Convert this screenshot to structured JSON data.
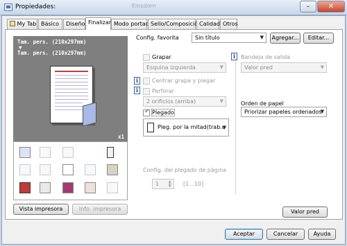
{
  "window": {
    "title": "Propiedades:",
    "title_faded": "Einsdorn"
  },
  "tabs": [
    {
      "label": "My Tab"
    },
    {
      "label": "Básico"
    },
    {
      "label": "Diseño"
    },
    {
      "label": "Finalizar"
    },
    {
      "label": "Modo portada"
    },
    {
      "label": "Sello/Composición"
    },
    {
      "label": "Calidad"
    },
    {
      "label": "Otros"
    }
  ],
  "preview": {
    "line1": "Tam. pers. (210x297mm)",
    "arrow": "▼",
    "line2": "Tam. pers. (210x297mm)",
    "copies": "x1"
  },
  "left_buttons": {
    "printer_view": "Vista impresora",
    "printer_info": "Info. impresora"
  },
  "favorites": {
    "label": "Config. favorita",
    "value": "Sin título",
    "add": "Agregar...",
    "edit": "Editar..."
  },
  "staple": {
    "label": "Grapar",
    "position": "Esquina izquierda"
  },
  "center_staple": {
    "label": "Centrar grapa y plegar"
  },
  "punch": {
    "label": "Perforar",
    "option": "2 orificios (arriba)"
  },
  "fold": {
    "label": "Plegado",
    "option": "Pleg. por la mitad(trab.c"
  },
  "output_tray": {
    "label": "Bandeja de salida",
    "value": "Valor pred"
  },
  "paper_order": {
    "label": "Orden de papel",
    "value": "Priorizar papeles ordenados"
  },
  "fold_pages": {
    "label": "Config. del plegado de página",
    "value": "1",
    "range": "[1...10]"
  },
  "defaults_button": "Valor pred",
  "footer": {
    "accept": "Aceptar",
    "cancel": "Cancelar",
    "help": "Ayuda"
  }
}
